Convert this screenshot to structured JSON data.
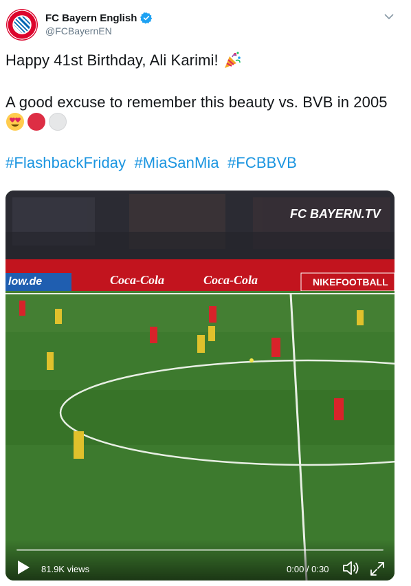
{
  "author": {
    "name": "FC Bayern English",
    "handle": "@FCBayernEN",
    "avatar_icon": "fc-bayern-logo",
    "verified_icon": "verified-badge-icon"
  },
  "tweet": {
    "line1": "Happy 41st Birthday, Ali Karimi!",
    "line1_emoji": "party-popper-emoji",
    "line2": "A good excuse to remember this beauty vs. BVB in 2005",
    "emojis": [
      "heart-eyes-emoji",
      "red-circle-emoji",
      "white-circle-emoji"
    ],
    "hashtags": [
      "#FlashbackFriday",
      "#MiaSanMia",
      "#FCBBVB"
    ]
  },
  "video": {
    "watermark": "FC BAYERN.TV",
    "ads": [
      "Coca-Cola",
      "Coca-Cola",
      "NIKEFOOTBALL",
      "low.de"
    ],
    "views": "81.9K views",
    "time": "0:00 / 0:30",
    "progress": 0
  },
  "colors": {
    "link": "#1b95e0",
    "bayern_red": "#dc052d",
    "pitch": "#3d7a2e"
  }
}
